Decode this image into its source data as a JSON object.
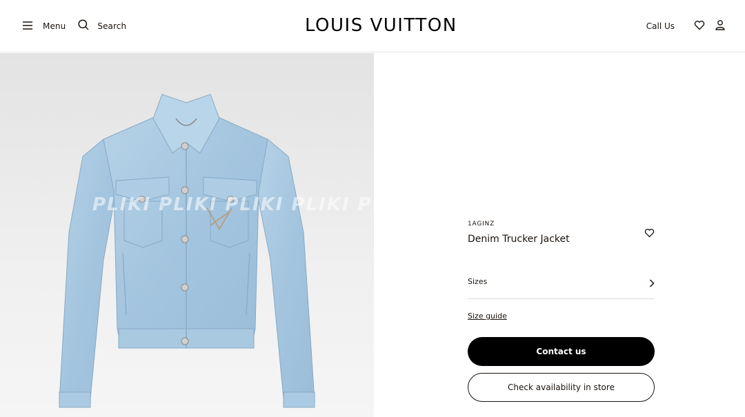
{
  "header": {
    "menu_label": "Menu",
    "search_label": "Search",
    "brand": "LOUIS VUITTON",
    "call_label": "Call Us",
    "icons": [
      "menu-icon",
      "search-icon",
      "heart-icon",
      "user-icon"
    ]
  },
  "gallery": {
    "watermark": "PLIKI    PLIKI    PLIKI    PLIKI    PLI"
  },
  "product": {
    "sku": "1AGINZ",
    "name": "Denim Trucker Jacket",
    "sizes_label": "Sizes",
    "size_guide_label": "Size guide",
    "contact_label": "Contact us",
    "availability_label": "Check availability in store"
  },
  "colors": {
    "text": "#19110b",
    "primary_button": "#000000",
    "denim": "#a8c8e0"
  }
}
